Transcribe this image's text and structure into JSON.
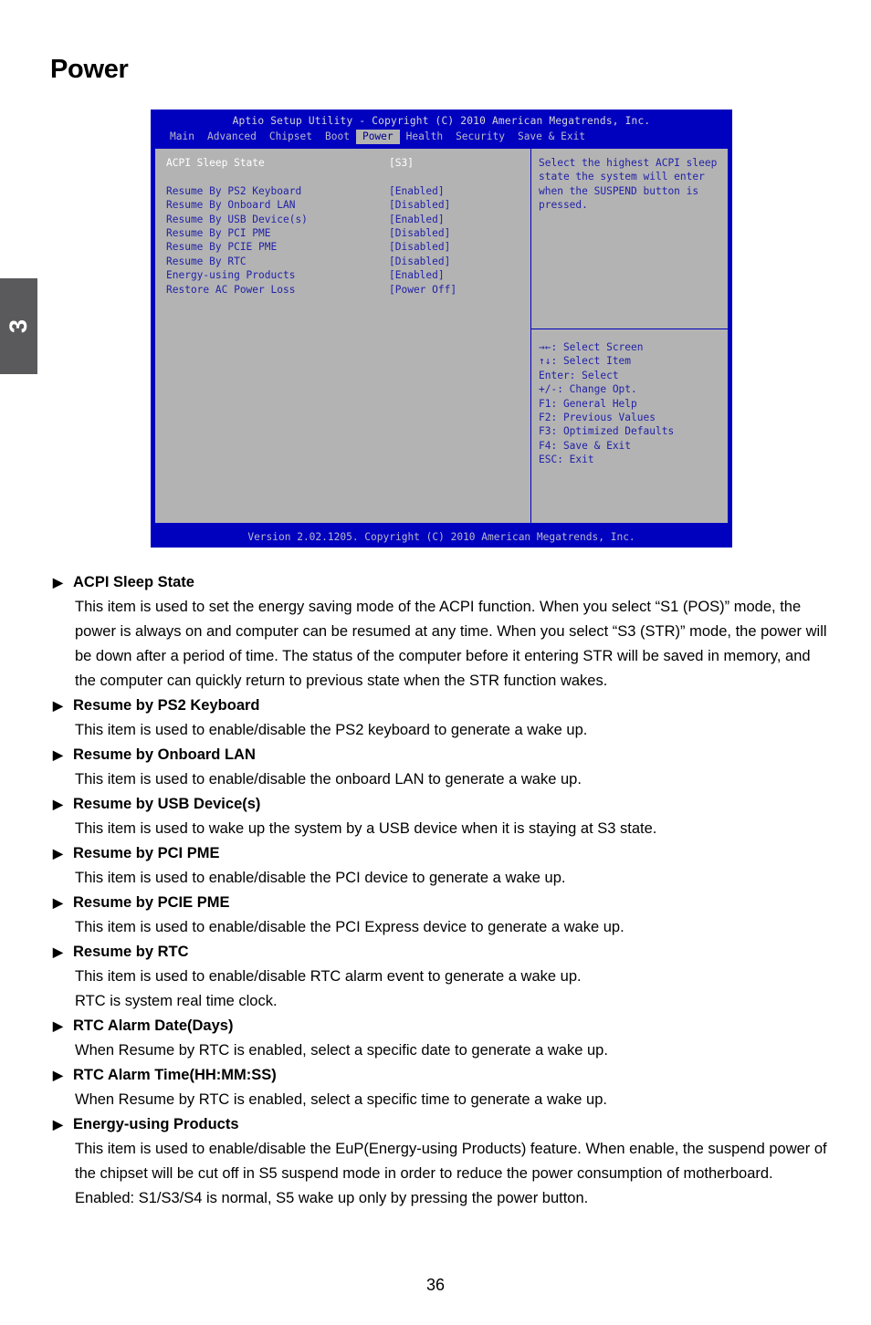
{
  "chapter_tab": {
    "number": "3"
  },
  "page_title": "Power",
  "page_number": "36",
  "bios": {
    "title": "Aptio Setup Utility - Copyright (C) 2010 American Megatrends, Inc.",
    "tabs": [
      {
        "label": "Main",
        "active": false
      },
      {
        "label": "Advanced",
        "active": false
      },
      {
        "label": "Chipset",
        "active": false
      },
      {
        "label": "Boot",
        "active": false
      },
      {
        "label": "Power",
        "active": true
      },
      {
        "label": "Health",
        "active": false
      },
      {
        "label": "Security",
        "active": false
      },
      {
        "label": "Save & Exit",
        "active": false
      }
    ],
    "options": [
      {
        "label": "ACPI Sleep State",
        "value": "[S3]",
        "selected": true
      },
      {
        "label": "",
        "value": "",
        "spacer": true
      },
      {
        "label": "Resume By PS2 Keyboard",
        "value": "[Enabled]",
        "selected": false
      },
      {
        "label": "Resume By Onboard LAN",
        "value": "[Disabled]",
        "selected": false
      },
      {
        "label": "Resume By USB Device(s)",
        "value": "[Enabled]",
        "selected": false
      },
      {
        "label": "Resume By PCI PME",
        "value": "[Disabled]",
        "selected": false
      },
      {
        "label": "Resume By PCIE PME",
        "value": "[Disabled]",
        "selected": false
      },
      {
        "label": "Resume By RTC",
        "value": "[Disabled]",
        "selected": false
      },
      {
        "label": "Energy-using Products",
        "value": "[Enabled]",
        "selected": false
      },
      {
        "label": "Restore AC Power Loss",
        "value": "[Power Off]",
        "selected": false
      }
    ],
    "help_lines": [
      "Select the highest ACPI sleep",
      "state the system will enter",
      "when the SUSPEND button is",
      "pressed."
    ],
    "key_lines": [
      "→←: Select Screen",
      "↑↓: Select Item",
      "Enter: Select",
      "+/-: Change Opt.",
      "F1: General Help",
      "F2: Previous Values",
      "F3: Optimized Defaults",
      "F4: Save & Exit",
      "ESC: Exit"
    ],
    "footer": "Version 2.02.1205. Copyright (C) 2010 American Megatrends, Inc."
  },
  "bullet_glyph": "▶",
  "entries": [
    {
      "heading": "ACPI Sleep State",
      "paragraphs": [
        "This item is used to set the energy saving mode of the ACPI function. When you select “S1 (POS)” mode, the power is always on and computer can be resumed at any time. When you select “S3 (STR)” mode, the power will be down after a period of time. The status of the computer before it entering STR will be saved in memory, and the computer can quickly return to previous state when the STR function wakes."
      ]
    },
    {
      "heading": "Resume by PS2 Keyboard",
      "paragraphs": [
        "This item is used to enable/disable the PS2 keyboard to generate a wake up."
      ]
    },
    {
      "heading": "Resume by Onboard LAN",
      "paragraphs": [
        "This item is used to enable/disable the onboard LAN to generate a wake up."
      ]
    },
    {
      "heading": "Resume by USB Device(s)",
      "paragraphs": [
        "This item is used to wake up the system by a USB device when it is staying at S3 state."
      ]
    },
    {
      "heading": "Resume by PCI PME",
      "paragraphs": [
        "This item is used to enable/disable the PCI device to generate a wake up."
      ]
    },
    {
      "heading": "Resume by PCIE PME",
      "paragraphs": [
        "This item is used to enable/disable the PCI Express device to generate a wake up."
      ]
    },
    {
      "heading": "Resume by RTC",
      "paragraphs": [
        "This item is used to enable/disable RTC alarm event to generate a wake up.",
        "RTC is system real time clock."
      ]
    },
    {
      "heading": "RTC Alarm Date(Days)",
      "paragraphs": [
        "When Resume by RTC is enabled, select a specific date to generate a wake up."
      ]
    },
    {
      "heading": "RTC Alarm Time(HH:MM:SS)",
      "paragraphs": [
        "When Resume by RTC is enabled, select a specific time to generate a wake up."
      ]
    },
    {
      "heading": "Energy-using Products",
      "paragraphs": [
        "This item is used to enable/disable the EuP(Energy-using Products) feature. When enable, the suspend power of the chipset will be cut off in S5 suspend mode in order to reduce the power consumption of motherboard.",
        "Enabled: S1/S3/S4 is normal, S5 wake up only by pressing the power button."
      ]
    }
  ],
  "colors": {
    "bios_blue": "#0000bf",
    "bios_gray": "#b3b3b3",
    "bios_text_blue": "#2222a8",
    "bios_title_text": "#d8d8d8",
    "chapter_tab_bg": "#5a5a5c"
  }
}
